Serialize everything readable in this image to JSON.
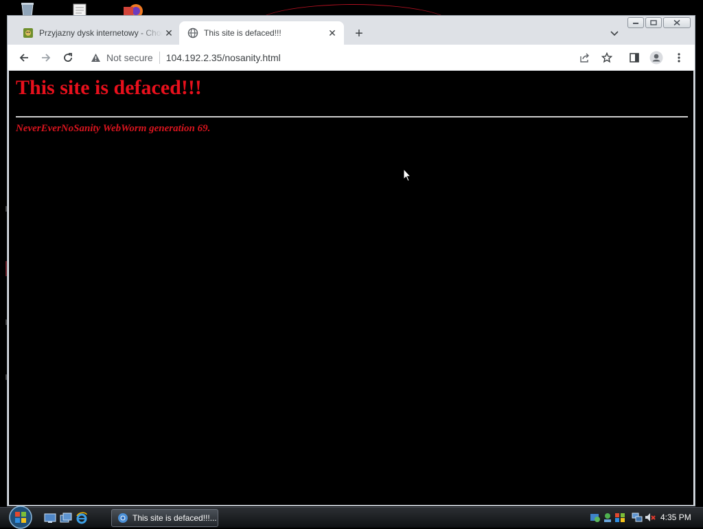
{
  "browser": {
    "tabs": [
      {
        "title": "Przyjazny dysk internetowy - Chomikuj.pl",
        "active": false
      },
      {
        "title": "This site is defaced!!!",
        "active": true
      }
    ],
    "address": {
      "security_label": "Not secure",
      "url": "104.192.2.35/nosanity.html"
    }
  },
  "page": {
    "heading": "This site is defaced!!!",
    "signature": "NeverEverNoSanity WebWorm generation 69."
  },
  "taskbar": {
    "task_button_label": "This site is defaced!!!...",
    "clock": "4:35 PM"
  },
  "colors": {
    "page_background": "#000000",
    "heading_red": "#e8101c",
    "browser_chrome": "#dee1e6",
    "taskbar": "#1b1e21"
  },
  "icons": [
    "recycle-bin-icon",
    "document-icon",
    "firefox-icon",
    "back-icon",
    "forward-icon",
    "reload-icon",
    "warning-icon",
    "share-icon",
    "bookmark-star-icon",
    "side-panel-icon",
    "profile-icon",
    "more-menu-icon",
    "globe-icon",
    "close-icon",
    "plus-icon",
    "chevron-down-icon",
    "windows-start-icon",
    "show-desktop-icon",
    "switch-windows-icon",
    "internet-explorer-icon",
    "chrome-icon",
    "network-icon",
    "volume-muted-icon"
  ]
}
